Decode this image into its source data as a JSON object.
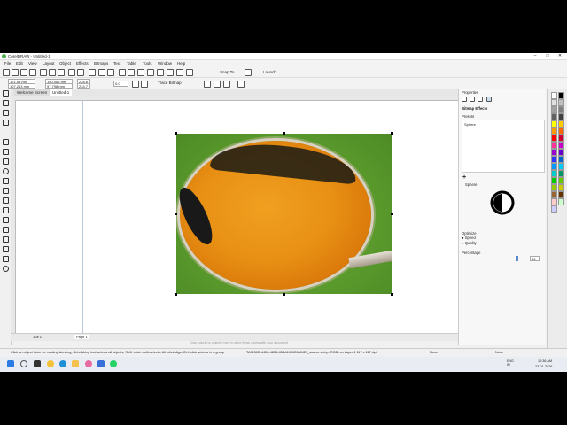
{
  "window": {
    "title": "CorelDRAW - Untitled-1",
    "min": "–",
    "max": "□",
    "close": "✕"
  },
  "menu": [
    "File",
    "Edit",
    "View",
    "Layout",
    "Object",
    "Effects",
    "Bitmaps",
    "Text",
    "Table",
    "Tools",
    "Window",
    "Help"
  ],
  "toolbar1": {
    "zoom_value": "Snap To",
    "launch_label": "Launch"
  },
  "toolbar2": {
    "x_value": "121.55 mm",
    "y_value": "107.213 mm",
    "w_value": "150.066 mm",
    "h_value": "97.798 mm",
    "sx_value": "228.6",
    "sy_value": "234.7",
    "zoom_pct": "100%",
    "rotation": "0.0",
    "trace_bitmap": "Trace Bitmap"
  },
  "tabs": {
    "welcome": "Welcome Screen",
    "doc": "Untitled-1"
  },
  "status": {
    "page_label": "Page 1",
    "page_count": "1 of 1",
    "hint_top": "Drag colors (or objects) here to store these colors with your document",
    "info": "Click an object twice for rotating/skewing; dbl-clicking tool selects all objects; Shift+click multi-selects; Alt+click digs; Ctrl+click selects in a group",
    "object": "TA7150D-4450-4854-4B6A10502088421_source.webp (RGB) on Layer 1 117 x 117 dpi",
    "fill_none": "None",
    "outline_none": "None"
  },
  "properties": {
    "title": "Properties",
    "section": "Bitmap Effects",
    "presets_label": "Presets",
    "preset_item": "Sphere",
    "effect_name": "Sphere",
    "optimize_label": "Optimize",
    "opt_speed": "Speed",
    "opt_quality": "Quality",
    "percentage_label": "Percentage",
    "percentage_value": "56"
  },
  "taskbar": {
    "weather": "",
    "lang": "ENG\nIN",
    "time": "10:36 AM",
    "date": "23-01-2026"
  },
  "palette_colors": [
    "#ffffff",
    "#000000",
    "#e0e0e0",
    "#c0c0c0",
    "#a0a0a0",
    "#808080",
    "#606060",
    "#404040",
    "#ffff00",
    "#ffcc00",
    "#ff9900",
    "#ff6600",
    "#ff0000",
    "#cc0033",
    "#ff3399",
    "#cc00cc",
    "#9900cc",
    "#6600cc",
    "#3333ff",
    "#0066cc",
    "#0099ff",
    "#00ccff",
    "#00cccc",
    "#009966",
    "#00cc00",
    "#66cc00",
    "#99cc00",
    "#cccc00",
    "#996633",
    "#663300",
    "#ffcccc",
    "#ccffcc",
    "#ccccff"
  ]
}
